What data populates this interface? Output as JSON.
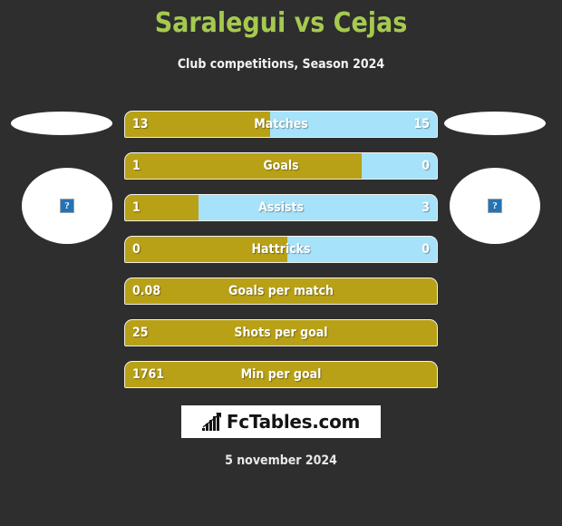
{
  "header": {
    "title": "Saralegui vs Cejas",
    "subtitle": "Club competitions, Season 2024",
    "title_color": "#a5ca4f"
  },
  "theme": {
    "background": "#2e2e2e",
    "home_color": "#b8a117",
    "away_color": "#a6e2fa",
    "text_color": "#ffffff"
  },
  "crests": {
    "left": {
      "placeholder_icon": "broken-image-icon",
      "placeholder_glyph": "?"
    },
    "right": {
      "placeholder_icon": "broken-image-icon",
      "placeholder_glyph": "?"
    }
  },
  "chart_data": {
    "type": "bar",
    "title": "Saralegui vs Cejas",
    "subtitle": "Club competitions, Season 2024",
    "orientation": "horizontal-diverging",
    "grid": false,
    "legend": "none",
    "series": [
      {
        "name": "Saralegui",
        "color": "#b8a117",
        "side": "left"
      },
      {
        "name": "Cejas",
        "color": "#a6e2fa",
        "side": "right"
      }
    ],
    "categories": [
      "Matches",
      "Goals",
      "Assists",
      "Hattricks",
      "Goals per match",
      "Shots per goal",
      "Min per goal"
    ],
    "rows": [
      {
        "label": "Matches",
        "left_value": "13",
        "right_value": "15",
        "left_pct": 46.4,
        "comparison": true
      },
      {
        "label": "Goals",
        "left_value": "1",
        "right_value": "0",
        "left_pct": 76.0,
        "comparison": true
      },
      {
        "label": "Assists",
        "left_value": "1",
        "right_value": "3",
        "left_pct": 23.6,
        "comparison": true
      },
      {
        "label": "Hattricks",
        "left_value": "0",
        "right_value": "0",
        "left_pct": 52.0,
        "comparison": true
      },
      {
        "label": "Goals per match",
        "left_value": "0.08",
        "right_value": "",
        "left_pct": 100.0,
        "comparison": false
      },
      {
        "label": "Shots per goal",
        "left_value": "25",
        "right_value": "",
        "left_pct": 100.0,
        "comparison": false
      },
      {
        "label": "Min per goal",
        "left_value": "1761",
        "right_value": "",
        "left_pct": 100.0,
        "comparison": false
      }
    ]
  },
  "footer": {
    "logo_text": "FcTables.com",
    "logo_icon": "bar-chart-trend-icon",
    "date": "5 november 2024"
  }
}
